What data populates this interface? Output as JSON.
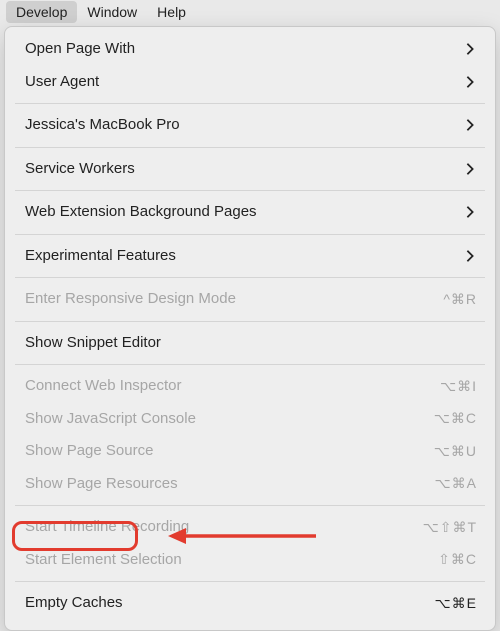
{
  "menubar": {
    "items": [
      {
        "label": "Develop",
        "active": true
      },
      {
        "label": "Window",
        "active": false
      },
      {
        "label": "Help",
        "active": false
      }
    ]
  },
  "menu": {
    "openPageWith": "Open Page With",
    "userAgent": "User Agent",
    "device": "Jessica's MacBook Pro",
    "serviceWorkers": "Service Workers",
    "webExtBg": "Web Extension Background Pages",
    "experimental": "Experimental Features",
    "responsive": {
      "label": "Enter Responsive Design Mode",
      "shortcut": "^⌘R"
    },
    "snippet": "Show Snippet Editor",
    "connectInspector": {
      "label": "Connect Web Inspector",
      "shortcut": "⌥⌘I"
    },
    "jsConsole": {
      "label": "Show JavaScript Console",
      "shortcut": "⌥⌘C"
    },
    "pageSource": {
      "label": "Show Page Source",
      "shortcut": "⌥⌘U"
    },
    "pageResources": {
      "label": "Show Page Resources",
      "shortcut": "⌥⌘A"
    },
    "timeline": {
      "label": "Start Timeline Recording",
      "shortcut": "⌥⇧⌘T"
    },
    "elementSel": {
      "label": "Start Element Selection",
      "shortcut": "⇧⌘C"
    },
    "emptyCaches": {
      "label": "Empty Caches",
      "shortcut": "⌥⌘E"
    }
  },
  "annotation": {
    "color": "#e23b2e"
  }
}
